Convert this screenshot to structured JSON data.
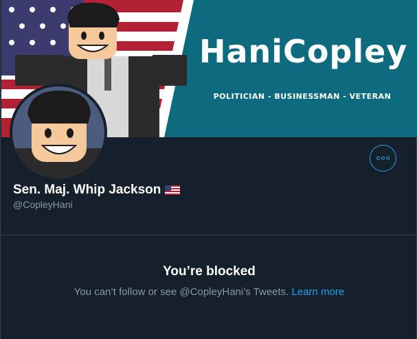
{
  "banner": {
    "title": "HaniCopley",
    "subtitle": "POLITICIAN - BUSINESSMAN - VETERAN",
    "accent_color": "#0e6b7e"
  },
  "profile": {
    "display_name": "Sen. Maj. Whip Jackson",
    "flag_icon": "us-flag-icon",
    "handle": "@CopleyHani",
    "more_icon": "more-options-icon"
  },
  "blocked": {
    "title": "You’re blocked",
    "message_prefix": "You can’t follow or see @CopleyHani’s Tweets. ",
    "learn_more": "Learn more"
  },
  "colors": {
    "background": "#15202b",
    "accent": "#1da1f2",
    "secondary_text": "#8899a6",
    "border": "#38444d"
  }
}
